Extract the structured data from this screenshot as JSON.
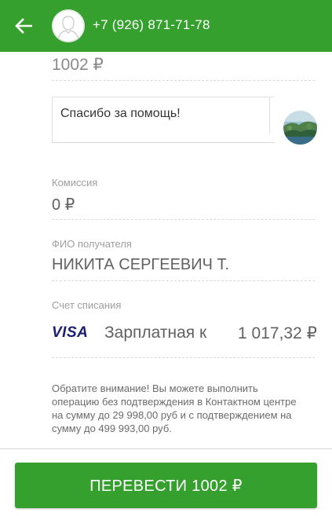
{
  "header": {
    "phone": "+7 (926) 871-71-78",
    "back_icon": "arrow-left-icon",
    "avatar_icon": "person-outline-icon",
    "color": "#36a02f"
  },
  "amount": "1002 ₽",
  "message": "Спасибо за помощь!",
  "commission": {
    "label": "Комиссия",
    "value": "0 ₽"
  },
  "recipient": {
    "label": "ФИО получателя",
    "value": "НИКИТА СЕРГЕЕВИЧ Т."
  },
  "account": {
    "label": "Счет списания",
    "card_brand": "VISA",
    "card_name": "Зарплатная к",
    "balance": "1 017,32 ₽"
  },
  "notice": "Обратите внимание! Вы можете выполнить операцию без подтверждения в Контактном центре на сумму до 29 998,00 руб и с подтверждением на сумму до 499 993,00 руб.",
  "submit": {
    "label": "ПЕРЕВЕСТИ 1002 ₽"
  }
}
